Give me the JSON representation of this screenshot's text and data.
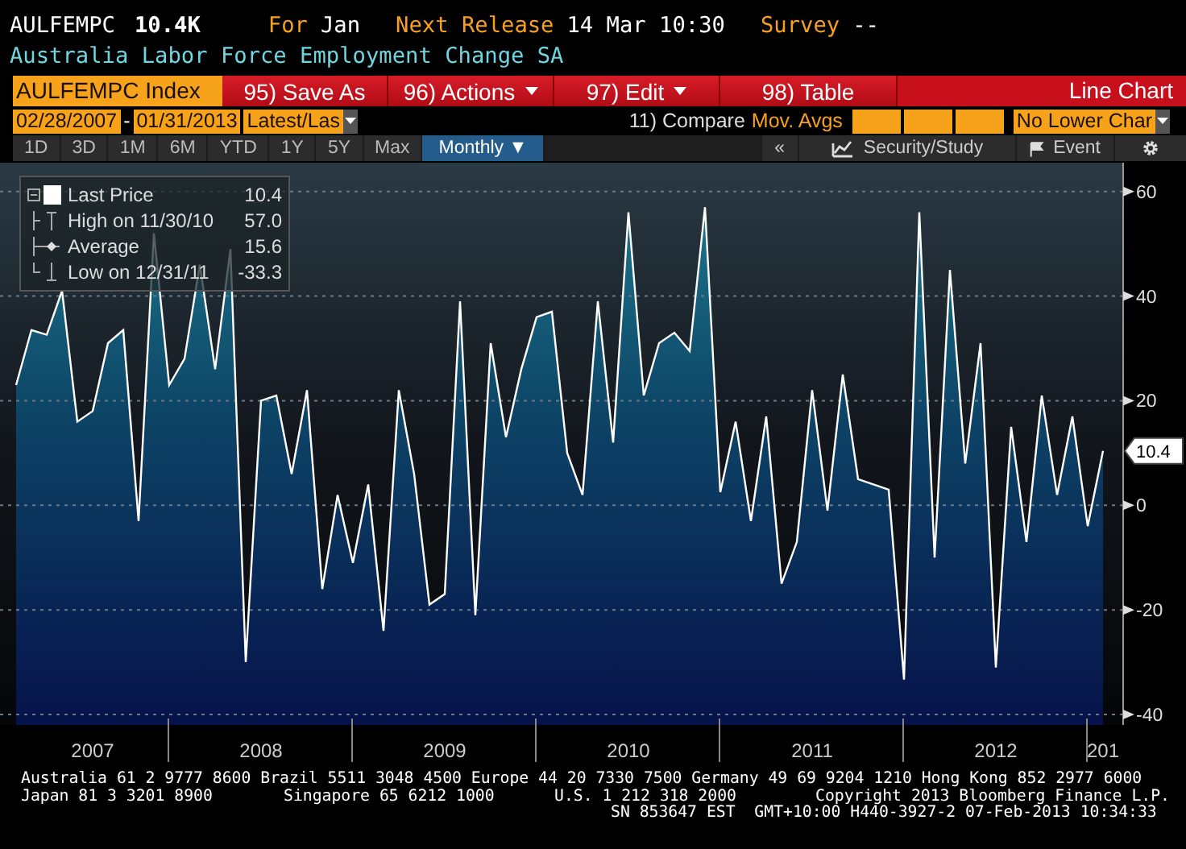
{
  "header": {
    "ticker": "AULFEMPC",
    "value": "10.4K",
    "fields": [
      {
        "label": "For",
        "value": "Jan"
      },
      {
        "label": "Next Release",
        "value": "14 Mar 10:30"
      },
      {
        "label": "Survey",
        "value": "--"
      }
    ],
    "title": "Australia Labor Force Employment Change SA"
  },
  "toolbar": {
    "index_field": "AULFEMPC Index",
    "buttons": [
      {
        "label": "95) Save As",
        "dropdown": false
      },
      {
        "label": "96) Actions",
        "dropdown": true
      },
      {
        "label": "97) Edit",
        "dropdown": true
      },
      {
        "label": "98) Table",
        "dropdown": false
      }
    ],
    "chart_type": "Line Chart"
  },
  "range_bar": {
    "start_date": "02/28/2007",
    "separator": "-",
    "end_date": "01/31/2013",
    "period": "Latest/Las",
    "compare_label": "11) Compare",
    "compare_field": "Mov. Avgs",
    "lower_chart": "No Lower Char"
  },
  "period_tabs": [
    {
      "label": "1D",
      "selected": false
    },
    {
      "label": "3D",
      "selected": false
    },
    {
      "label": "1M",
      "selected": false
    },
    {
      "label": "6M",
      "selected": false
    },
    {
      "label": "YTD",
      "selected": false
    },
    {
      "label": "1Y",
      "selected": false
    },
    {
      "label": "5Y",
      "selected": false
    },
    {
      "label": "Max",
      "selected": false
    },
    {
      "label": "Monthly ▼",
      "selected": true
    }
  ],
  "chart_tools": {
    "collapse": "«",
    "security_study": "Security/Study",
    "event": "Event"
  },
  "legend": [
    {
      "kind": "last",
      "value": "10.4"
    },
    {
      "kind": "high",
      "label": "High on 11/30/10",
      "value": "57.0"
    },
    {
      "kind": "average",
      "label": "Average",
      "value": "15.6"
    },
    {
      "kind": "low",
      "label": "Low on 12/31/11",
      "value": "-33.3"
    }
  ],
  "last_value_tag": "10.4",
  "chart_data": {
    "type": "area",
    "grid": true,
    "ylim": [
      -42,
      65.5
    ],
    "yticks": [
      -40,
      -20,
      0,
      20,
      40,
      60
    ],
    "categories": [
      null,
      null,
      null,
      null,
      null,
      "2007",
      null,
      null,
      null,
      null,
      null,
      null,
      null,
      null,
      null,
      null,
      "2008",
      null,
      null,
      null,
      null,
      null,
      null,
      null,
      null,
      null,
      null,
      null,
      "2009",
      null,
      null,
      null,
      null,
      null,
      null,
      null,
      null,
      null,
      null,
      null,
      "2010",
      null,
      null,
      null,
      null,
      null,
      null,
      null,
      null,
      null,
      null,
      null,
      "2011",
      null,
      null,
      null,
      null,
      null,
      null,
      null,
      null,
      null,
      null,
      null,
      "2012",
      null,
      null,
      null,
      null,
      null,
      null,
      "201"
    ],
    "series": [
      {
        "name": "Last Price",
        "color": "#ffffff",
        "values": [
          23,
          33.5,
          32.6,
          41,
          16,
          18,
          31,
          33.5,
          -3,
          52,
          23,
          28,
          46,
          26,
          49,
          -30,
          20,
          21,
          6,
          22,
          -16,
          2,
          -11,
          4,
          -24,
          22,
          6,
          -19,
          -17,
          39,
          -21,
          31,
          13,
          26,
          36,
          37,
          10,
          2,
          39,
          12,
          56,
          21,
          31,
          33,
          29.5,
          57,
          2.5,
          16,
          -3,
          17,
          -15,
          -7,
          22,
          -1,
          25,
          5,
          4,
          3,
          -33.3,
          56,
          -10,
          45,
          8,
          31,
          -31,
          15,
          -7,
          21,
          2,
          17,
          -4,
          10.4
        ]
      }
    ]
  },
  "footer": [
    [
      "Australia 61 2 9777 8600 Brazil 5511 3048 4500 Europe 44 20 7330 7500 Germany 49 69 9204 1210 Hong Kong 852 2977 6000"
    ],
    [
      "Japan 81 3 3201 8900",
      "Singapore 65 6212 1000",
      "U.S. 1 212 318 2000",
      "Copyright 2013 Bloomberg Finance L.P."
    ],
    [
      "SN 853647 EST  GMT+10:00 H440-3927-2 07-Feb-2013 10:34:33"
    ]
  ]
}
